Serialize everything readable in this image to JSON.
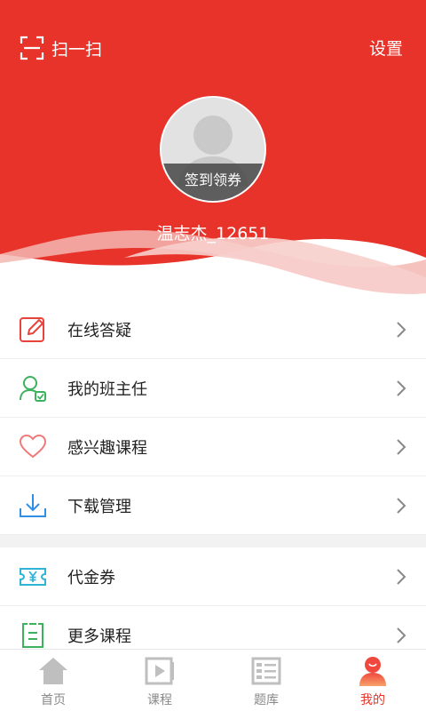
{
  "colors": {
    "brand_red": "#e8332a",
    "active_tab": "#e8332a",
    "icon_red": "#e8433a",
    "icon_green": "#3cb25e",
    "icon_pink": "#f07a7a",
    "icon_blue": "#2f8fe6"
  },
  "header": {
    "scan_label": "扫一扫",
    "settings_label": "设置"
  },
  "profile": {
    "signin_label": "签到领券",
    "username": "温志杰_12651"
  },
  "menu_group_1": [
    {
      "label": "在线答疑",
      "icon": "edit-icon"
    },
    {
      "label": "我的班主任",
      "icon": "user-check-icon"
    },
    {
      "label": "感兴趣课程",
      "icon": "heart-icon"
    },
    {
      "label": "下载管理",
      "icon": "download-icon"
    }
  ],
  "menu_group_2": [
    {
      "label": "代金券",
      "icon": "voucher-icon"
    },
    {
      "label": "更多课程",
      "icon": "list-icon"
    }
  ],
  "tabbar": [
    {
      "label": "首页",
      "icon": "home-icon",
      "active": false
    },
    {
      "label": "课程",
      "icon": "video-icon",
      "active": false
    },
    {
      "label": "题库",
      "icon": "question-bank-icon",
      "active": false
    },
    {
      "label": "我的",
      "icon": "me-icon",
      "active": true
    }
  ]
}
